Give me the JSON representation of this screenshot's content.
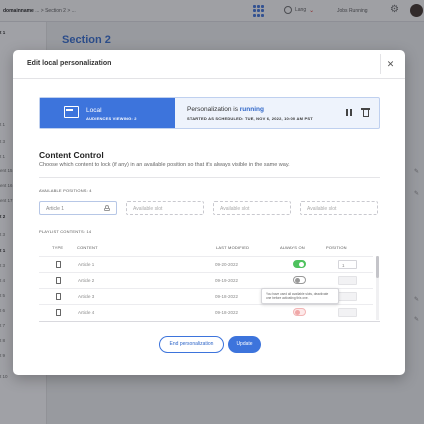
{
  "topbar": {
    "breadcrumb_domain": "domainname",
    "breadcrumb_rest": " ... > Section 2 > ...",
    "lang_label": "Lang",
    "status_label": "Jobs Running"
  },
  "sidebar": {
    "rows": [
      "t 1",
      "-",
      "-",
      "-",
      "-",
      "-",
      "-",
      "-",
      "t 1",
      "t 3",
      "t 1",
      "ent 15",
      "ent 16",
      "ent 17",
      "t 2",
      "t 3",
      "t 1",
      "t 3",
      "t 4",
      "t 5",
      "t 6",
      "t 7",
      "t 8",
      "t 9",
      "t 10"
    ]
  },
  "background": {
    "section_title": "Section 2"
  },
  "modal": {
    "title": "Edit local personalization",
    "close_glyph": "✕"
  },
  "banner": {
    "name": "Local",
    "audiences": "AUDIENCES VIEWING: 2",
    "status_prefix": "Personalization is ",
    "status_value": "running",
    "started": "STARTED AS SCHEDULED: TUE, NOV 6, 2022, 10:00 AM PST",
    "accent": "#3d74dc"
  },
  "content_control": {
    "title": "Content Control",
    "description": "Choose which content to lock (if any) in an available position so that it's always visible in the same way.",
    "positions_label": "AVAILABLE POSITIONS: 4",
    "slots": [
      "Article 1",
      "Available slot",
      "Available slot",
      "Available slot"
    ],
    "playlist_label": "PLAYLIST CONTENTS: 14"
  },
  "table": {
    "headers": [
      "TYPE",
      "CONTENT",
      "LAST MODIFIED",
      "ALWAYS ON",
      "POSITION"
    ],
    "rows": [
      {
        "content": "Article 1",
        "modified": "09-20-2022",
        "always_on": "on",
        "position": "1"
      },
      {
        "content": "Article 2",
        "modified": "09-19-2022",
        "always_on": "off",
        "position": ""
      },
      {
        "content": "Article 3",
        "modified": "09-18-2022",
        "always_on": "off",
        "position": ""
      },
      {
        "content": "Article 4",
        "modified": "09-18-2022",
        "always_on": "disabled",
        "position": ""
      }
    ]
  },
  "tooltip": {
    "text": "You have used all available slots, deactivate one before activating this one."
  },
  "buttons": {
    "end": "End personalization",
    "update": "Update"
  }
}
